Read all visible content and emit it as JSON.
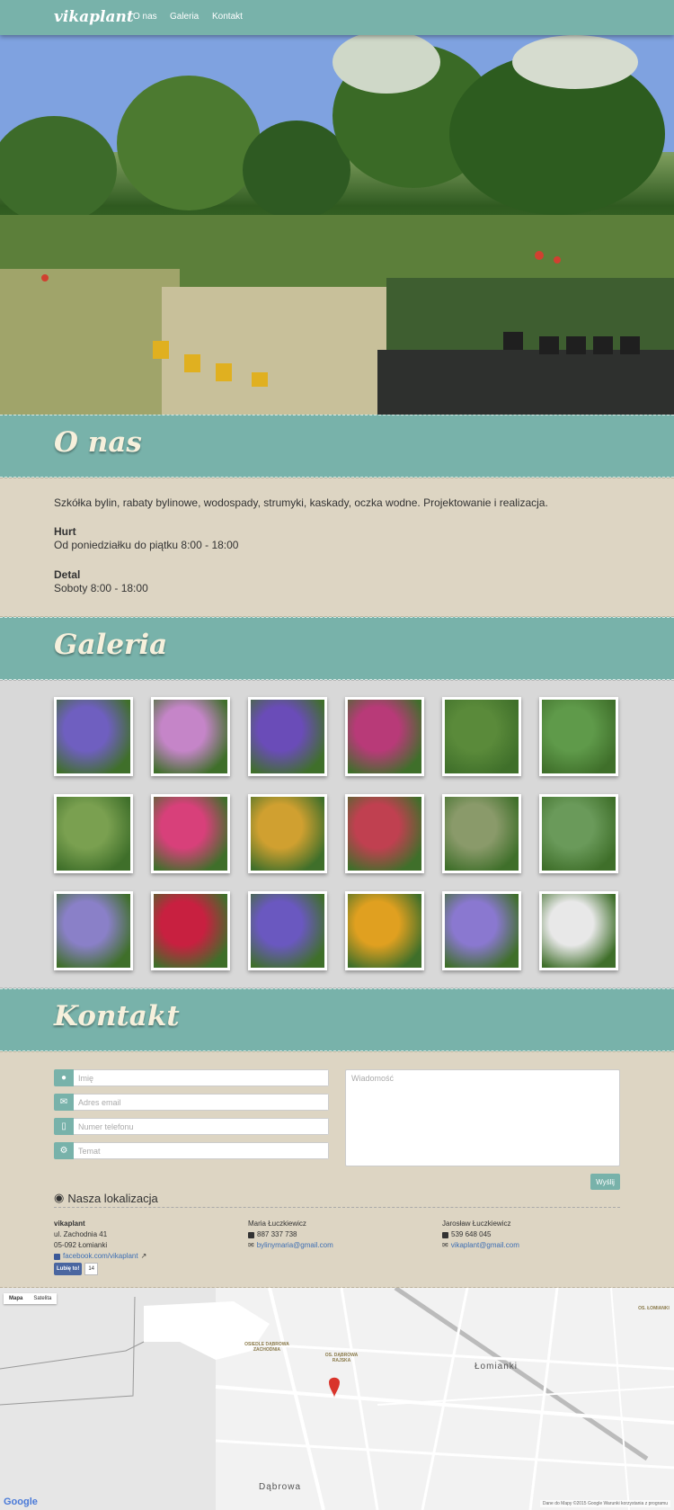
{
  "nav": {
    "brand": "vikaplant",
    "items": [
      "O nas",
      "Galeria",
      "Kontakt"
    ]
  },
  "about": {
    "title": "O nas",
    "intro": "Szkółka bylin, rabaty bylinowe, wodospady, strumyki, kaskady, oczka wodne. Projektowanie i realizacja.",
    "wholesale_heading": "Hurt",
    "wholesale_hours": "Od poniedziałku do piątku 8:00 - 18:00",
    "retail_heading": "Detal",
    "retail_hours": "Soboty 8:00 - 18:00"
  },
  "gallery": {
    "title": "Galeria",
    "thumb_colors": [
      [
        "#6f5fc0",
        "#c585c8",
        "#6a4cb8",
        "#b83a78",
        "#5a8a3a",
        "#5f9a4a"
      ],
      [
        "#7aa050",
        "#d8407a",
        "#d0a030",
        "#c04050",
        "#8a9a6a",
        "#6a9a5a"
      ],
      [
        "#8a80c8",
        "#c82040",
        "#6a58c0",
        "#e0a020",
        "#8a78d0",
        "#e8e8e8"
      ]
    ]
  },
  "contact": {
    "title": "Kontakt",
    "name_placeholder": "Imię",
    "email_placeholder": "Adres email",
    "phone_placeholder": "Numer telefonu",
    "subject_placeholder": "Temat",
    "message_placeholder": "Wiadomość",
    "send_label": "Wyślij",
    "location_title": "Nasza lokalizacja",
    "company": {
      "name": "vikaplant",
      "street": "ul. Zachodnia 41",
      "city": "05-092 Łomianki",
      "facebook": "facebook.com/vikaplant",
      "like_label": "Lubię to!",
      "like_count": "14"
    },
    "person1": {
      "name": "Maria Łuczkiewicz",
      "phone": "887 337 738",
      "email": "bylinymaria@gmail.com"
    },
    "person2": {
      "name": "Jarosław Łuczkiewicz",
      "phone": "539 648 045",
      "email": "vikaplant@gmail.com"
    }
  },
  "map": {
    "tab_map": "Mapa",
    "tab_satellite": "Satelita",
    "town_lomianki": "Łomianki",
    "town_dabrowa": "Dąbrowa",
    "area1": "OSIEDLE DĄBROWA ZACHODNIA",
    "area2": "OS. DĄBROWA RAJSKA",
    "area3": "OS. ŁOMIANKI",
    "google": "Google",
    "footer": "Dane do Mapy ©2015 Google   Warunki korzystania z programu"
  }
}
